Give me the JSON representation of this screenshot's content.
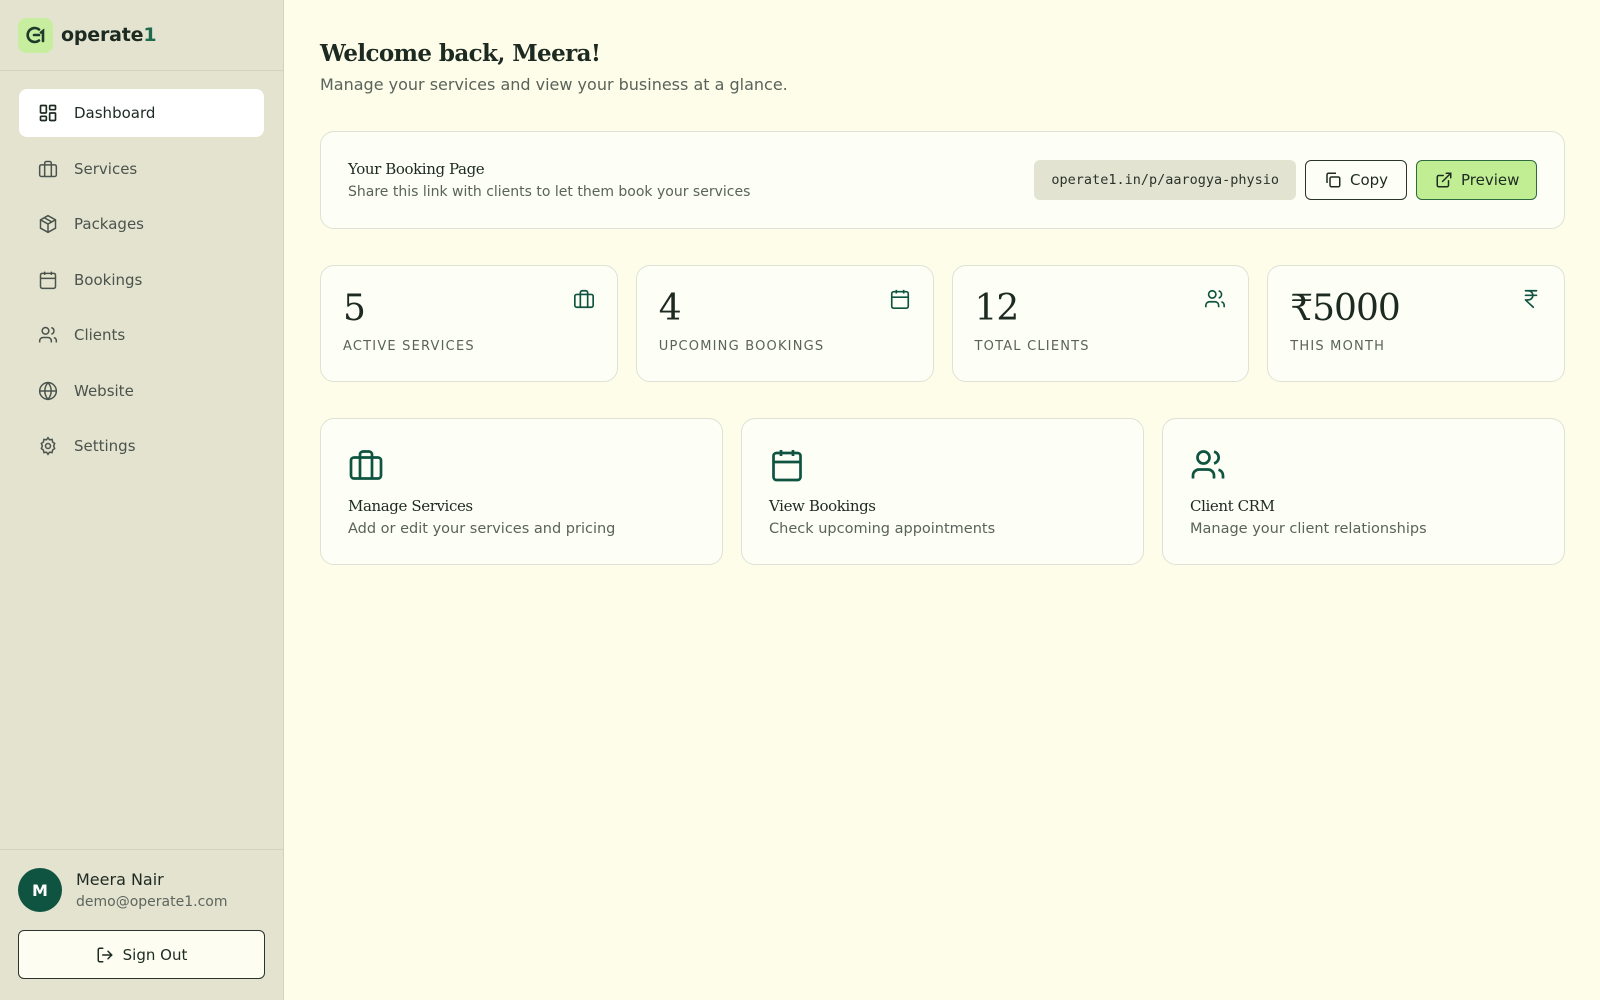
{
  "brand": {
    "name_prefix": "operate",
    "name_suffix": "1"
  },
  "sidebar": {
    "items": [
      {
        "label": "Dashboard",
        "icon": "dashboard-icon",
        "active": true
      },
      {
        "label": "Services",
        "icon": "briefcase-icon"
      },
      {
        "label": "Packages",
        "icon": "package-icon"
      },
      {
        "label": "Bookings",
        "icon": "calendar-icon"
      },
      {
        "label": "Clients",
        "icon": "users-icon"
      },
      {
        "label": "Website",
        "icon": "globe-icon"
      },
      {
        "label": "Settings",
        "icon": "gear-icon"
      }
    ]
  },
  "user": {
    "initial": "M",
    "name": "Meera Nair",
    "email": "demo@operate1.com",
    "signout_label": "Sign Out"
  },
  "header": {
    "title": "Welcome back, Meera!",
    "subtitle": "Manage your services and view your business at a glance."
  },
  "booking_page": {
    "title": "Your Booking Page",
    "description": "Share this link with clients to let them book your services",
    "url": "operate1.in/p/aarogya-physio",
    "copy_label": "Copy",
    "preview_label": "Preview"
  },
  "stats": [
    {
      "value": "5",
      "label": "ACTIVE SERVICES",
      "icon": "briefcase-icon"
    },
    {
      "value": "4",
      "label": "UPCOMING BOOKINGS",
      "icon": "calendar-icon"
    },
    {
      "value": "12",
      "label": "TOTAL CLIENTS",
      "icon": "users-icon"
    },
    {
      "value": "₹5000",
      "label": "THIS MONTH",
      "icon": "rupee-icon"
    }
  ],
  "quick_links": [
    {
      "title": "Manage Services",
      "description": "Add or edit your services and pricing",
      "icon": "briefcase-icon"
    },
    {
      "title": "View Bookings",
      "description": "Check upcoming appointments",
      "icon": "calendar-icon"
    },
    {
      "title": "Client CRM",
      "description": "Manage your client relationships",
      "icon": "users-icon"
    }
  ],
  "colors": {
    "accent": "#0f5440",
    "preview_button": "#c2ee93",
    "background": "#fdfde9",
    "sidebar": "#e4e3d0"
  }
}
